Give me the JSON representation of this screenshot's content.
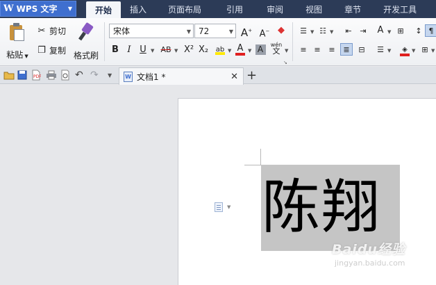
{
  "app": {
    "name": "WPS 文字",
    "logo": "W"
  },
  "menu": {
    "tabs": [
      {
        "label": "开始",
        "active": true
      },
      {
        "label": "插入"
      },
      {
        "label": "页面布局"
      },
      {
        "label": "引用"
      },
      {
        "label": "审阅"
      },
      {
        "label": "视图"
      },
      {
        "label": "章节"
      },
      {
        "label": "开发工具"
      }
    ]
  },
  "ribbon": {
    "clipboard": {
      "paste": "粘贴",
      "cut": "剪切",
      "copy": "复制",
      "format_painter": "格式刷"
    },
    "font": {
      "name": "宋体",
      "size": "72",
      "bold": "B",
      "italic": "I",
      "underline": "U",
      "strike": "AB",
      "superscript": "X²",
      "subscript": "X₂",
      "grow": "A",
      "shrink": "A",
      "phonetic": "wén",
      "phonetic_char": "文"
    },
    "colors": {
      "highlight": "#ffe800",
      "font_color": "#e02020",
      "accent": "#3f6fcf"
    }
  },
  "document": {
    "tab_title": "文档1 *",
    "content": "陈翔"
  },
  "watermark": {
    "brand": "Baidu经验",
    "url": "jingyan.baidu.com"
  }
}
